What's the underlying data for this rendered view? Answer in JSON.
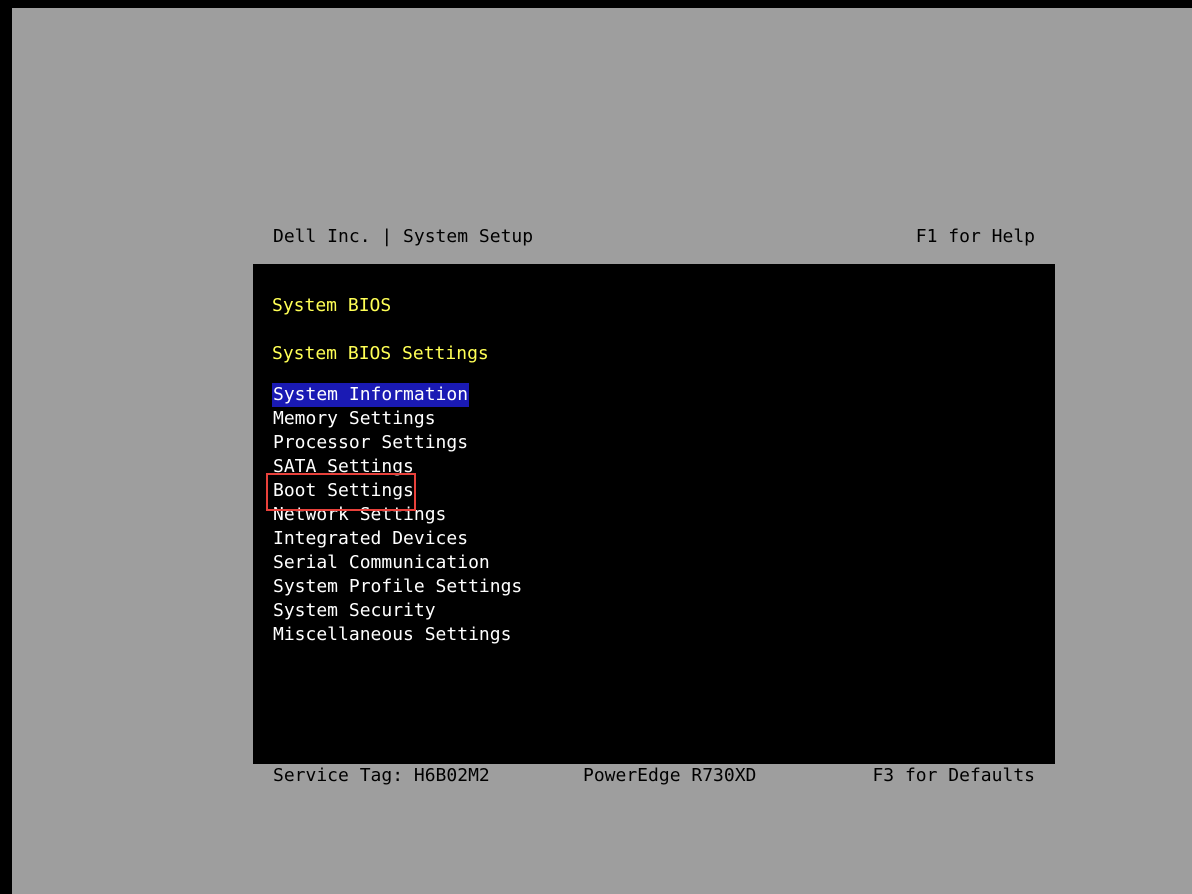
{
  "header": {
    "title": "Dell Inc. | System Setup",
    "help": "F1 for Help"
  },
  "panel": {
    "heading": "System BIOS",
    "subheading": "System BIOS Settings",
    "menu": [
      {
        "label": "System Information"
      },
      {
        "label": "Memory Settings"
      },
      {
        "label": "Processor Settings"
      },
      {
        "label": "SATA Settings"
      },
      {
        "label": "Boot Settings"
      },
      {
        "label": "Network Settings"
      },
      {
        "label": "Integrated Devices"
      },
      {
        "label": "Serial Communication"
      },
      {
        "label": "System Profile Settings"
      },
      {
        "label": "System Security"
      },
      {
        "label": "Miscellaneous Settings"
      }
    ],
    "selected_item": "System Information",
    "annotated_item": "Boot Settings"
  },
  "footer": {
    "service_tag": "Service Tag: H6B02M2",
    "model": "PowerEdge R730XD",
    "defaults": "F3 for Defaults"
  },
  "colors": {
    "screen_background": "#9e9e9e",
    "panel_background": "#000000",
    "heading_text": "#ffff55",
    "menu_text": "#ffffff",
    "selection_background": "#1a1ab4",
    "annotation_border": "#e8413b"
  }
}
